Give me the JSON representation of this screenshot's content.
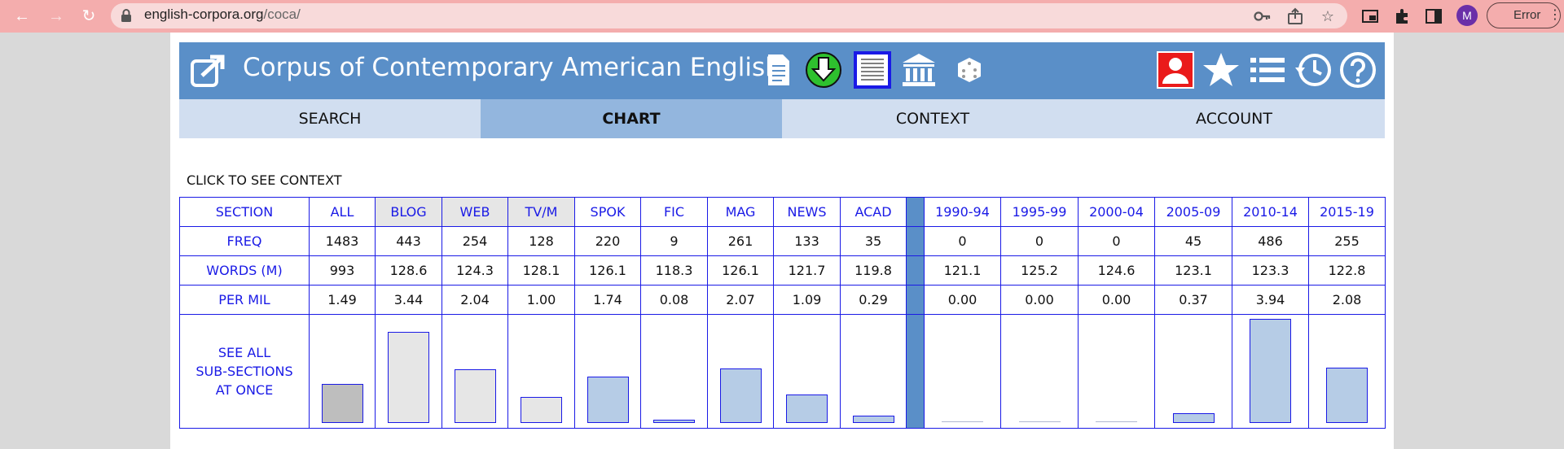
{
  "browser": {
    "url_host": "english-corpora.org",
    "url_path": "/coca/",
    "profile_initial": "M",
    "error_label": "Error"
  },
  "header": {
    "title": "Corpus of Contemporary American English"
  },
  "tabs": [
    {
      "label": "SEARCH"
    },
    {
      "label": "CHART"
    },
    {
      "label": "CONTEXT"
    },
    {
      "label": "ACCOUNT"
    }
  ],
  "click_label": "CLICK TO SEE CONTEXT",
  "table": {
    "row_labels": {
      "section": "SECTION",
      "freq": "FREQ",
      "words": "WORDS (M)",
      "permil": "PER MIL",
      "see_all_1": "SEE ALL",
      "see_all_2": "SUB-SECTIONS",
      "see_all_3": "AT ONCE"
    },
    "columns": [
      {
        "section": "ALL",
        "freq": "1483",
        "words": "993",
        "permil": "1.49"
      },
      {
        "section": "BLOG",
        "freq": "443",
        "words": "128.6",
        "permil": "3.44"
      },
      {
        "section": "WEB",
        "freq": "254",
        "words": "124.3",
        "permil": "2.04"
      },
      {
        "section": "TV/M",
        "freq": "128",
        "words": "128.1",
        "permil": "1.00"
      },
      {
        "section": "SPOK",
        "freq": "220",
        "words": "126.1",
        "permil": "1.74"
      },
      {
        "section": "FIC",
        "freq": "9",
        "words": "118.3",
        "permil": "0.08"
      },
      {
        "section": "MAG",
        "freq": "261",
        "words": "126.1",
        "permil": "2.07"
      },
      {
        "section": "NEWS",
        "freq": "133",
        "words": "121.7",
        "permil": "1.09"
      },
      {
        "section": "ACAD",
        "freq": "35",
        "words": "119.8",
        "permil": "0.29"
      },
      {
        "section": "1990-94",
        "freq": "0",
        "words": "121.1",
        "permil": "0.00"
      },
      {
        "section": "1995-99",
        "freq": "0",
        "words": "125.2",
        "permil": "0.00"
      },
      {
        "section": "2000-04",
        "freq": "0",
        "words": "124.6",
        "permil": "0.00"
      },
      {
        "section": "2005-09",
        "freq": "45",
        "words": "123.1",
        "permil": "0.37"
      },
      {
        "section": "2010-14",
        "freq": "486",
        "words": "123.3",
        "permil": "3.94"
      },
      {
        "section": "2015-19",
        "freq": "255",
        "words": "122.8",
        "permil": "2.08"
      }
    ]
  },
  "colors": {
    "chrome": "#f4adad",
    "header": "#5a8fc8",
    "tab_bg": "#d1def0",
    "tab_active": "#93b6de",
    "table_border": "#1a1ae6",
    "bar_fill": "#b6cce6"
  },
  "icons": [
    "back-arrow-icon",
    "forward-arrow-icon",
    "reload-icon",
    "lock-icon",
    "key-icon",
    "share-icon",
    "star-icon",
    "picture-in-picture-icon",
    "extensions-icon",
    "sidebar-icon",
    "external-link-icon",
    "document-icon",
    "download-icon",
    "book-icon",
    "library-icon",
    "dice-icon",
    "user-icon",
    "favorites-star-icon",
    "list-icon",
    "history-icon",
    "help-icon"
  ]
}
